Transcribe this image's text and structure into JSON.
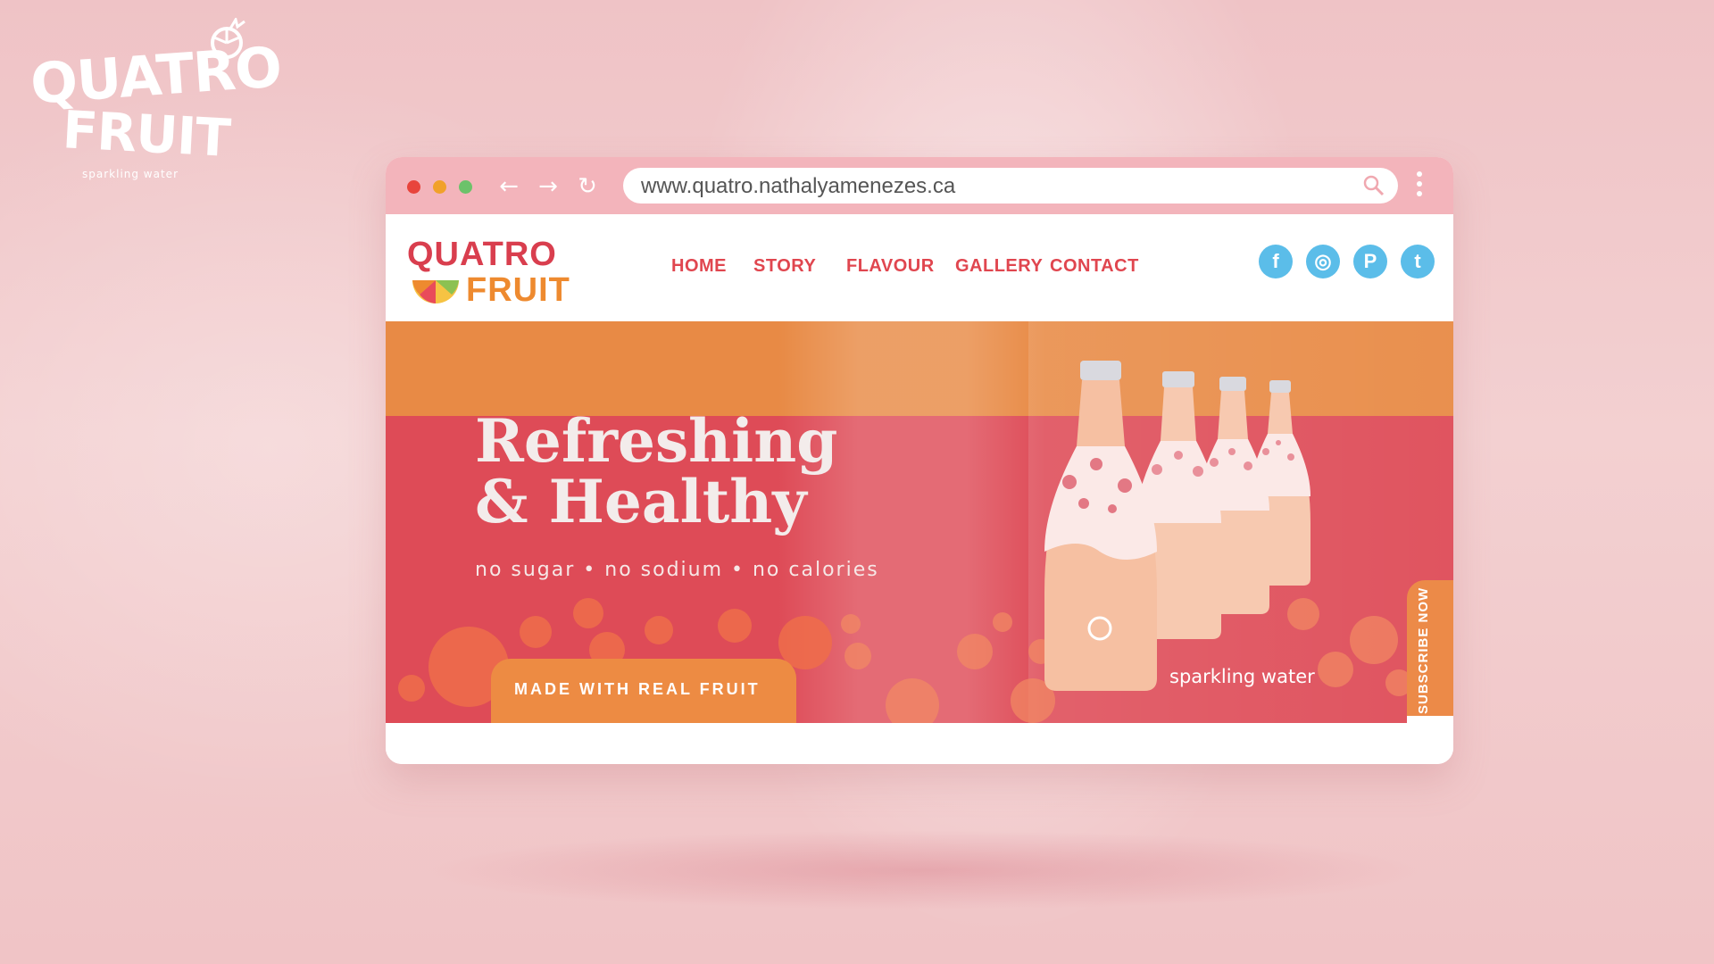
{
  "brand": {
    "corner_word1": "QUATRO",
    "corner_word2": "FRUIT",
    "corner_tagline": "sparkling water"
  },
  "browser": {
    "url": "www.quatro.nathalyamenezes.ca",
    "icons": [
      "back-arrow-icon",
      "forward-arrow-icon",
      "reload-icon",
      "search-icon",
      "kebab-menu-icon"
    ]
  },
  "site": {
    "logo_line1": "QUATRO",
    "logo_line2": "FRUIT",
    "nav": [
      "HOME",
      "STORY",
      "FLAVOUR",
      "GALLERY",
      "CONTACT"
    ],
    "social": [
      {
        "icon": "facebook-icon",
        "glyph": "f"
      },
      {
        "icon": "instagram-icon",
        "glyph": "◎"
      },
      {
        "icon": "pinterest-icon",
        "glyph": "P"
      },
      {
        "icon": "twitter-icon",
        "glyph": "t"
      }
    ]
  },
  "hero": {
    "headline_line1": "Refreshing",
    "headline_line2": "& Healthy",
    "subline": "no sugar • no sodium • no calories",
    "cta_label": "MADE WITH REAL FRUIT",
    "product_caption": "sparkling water",
    "subscribe_label": "SUBSCRIBE NOW"
  },
  "colors": {
    "background": "#f3d0d1",
    "chrome": "#f3b4bb",
    "hero_red": "#de4b57",
    "hero_orange": "#e88a45",
    "brand_red": "#d93e4e",
    "brand_orange": "#ee8a2f",
    "social_blue": "#5bbde9"
  }
}
